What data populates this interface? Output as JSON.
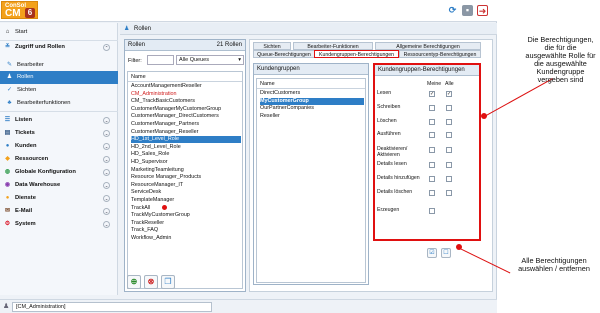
{
  "logo": {
    "line1": "ConSol",
    "line2": "CM",
    "badge": "6"
  },
  "sidebar": {
    "start": "Start",
    "section_access": "Zugriff und Rollen",
    "access_items": [
      {
        "label": "Bearbeiter",
        "icon": "user-edit-icon"
      },
      {
        "label": "Rollen",
        "icon": "roles-icon"
      },
      {
        "label": "Sichten",
        "icon": "check-icon"
      },
      {
        "label": "Bearbeiterfunktionen",
        "icon": "functions-icon"
      }
    ],
    "sections": [
      {
        "label": "Listen",
        "icon": "list-icon"
      },
      {
        "label": "Tickets",
        "icon": "ticket-icon"
      },
      {
        "label": "Kunden",
        "icon": "person-icon"
      },
      {
        "label": "Ressourcen",
        "icon": "resources-icon"
      },
      {
        "label": "Globale Konfiguration",
        "icon": "globe-icon"
      },
      {
        "label": "Data Warehouse",
        "icon": "warehouse-icon"
      },
      {
        "label": "Dienste",
        "icon": "services-icon"
      },
      {
        "label": "E-Mail",
        "icon": "mail-icon"
      },
      {
        "label": "System",
        "icon": "system-icon"
      }
    ]
  },
  "panel_title": "Rollen",
  "roles": {
    "header": "Rollen",
    "count": "21 Rollen",
    "filter_label": "Filter:",
    "filter_select": "Alle Queues",
    "column": "Name",
    "items": [
      "AccountManagementReseller",
      "CM_Administration",
      "CM_TrackBasicCustomers",
      "CustomerManagerMyCustomerGroup",
      "CustomerManager_DirectCustomers",
      "CustomerManager_Partners",
      "CustomerManager_Reseller",
      "HD_1st_Level_Role",
      "HD_2nd_Level_Role",
      "HD_Sales_Role",
      "HD_Supervisor",
      "MarketingTeamleitung",
      "Resource Manager_Products",
      "ResourceManager_IT",
      "ServiceDesk",
      "TemplateManager",
      "TrackAll",
      "TrackMyCustomerGroup",
      "TrackReseller",
      "Track_FAQ",
      "Workflow_Admin"
    ]
  },
  "tabs": {
    "row1": [
      "Sichten",
      "Bearbeiter-Funktionen",
      "Allgemeine Berechtigungen"
    ],
    "row2": [
      "Queue-Berechtigungen",
      "Kundengruppen-Berechtigungen",
      "Ressourcentyp-Berechtigungen"
    ]
  },
  "groups": {
    "header": "Kundengruppen",
    "column": "Name",
    "items": [
      "DirectCustomers",
      "MyCustomerGroup",
      "OurPartnerCompanies",
      "Reseller"
    ]
  },
  "perms": {
    "header": "Kundengruppen-Berechtigungen",
    "col_mine": "Meine",
    "col_all": "Alle",
    "rows": [
      {
        "label": "Lesen",
        "mine": true,
        "all": true
      },
      {
        "label": "Schreiben",
        "mine": false,
        "all": false
      },
      {
        "label": "Löschen",
        "mine": false,
        "all": false
      },
      {
        "label": "Ausführen",
        "mine": false,
        "all": false
      },
      {
        "label": "Deaktivieren/ Aktivieren",
        "mine": false,
        "all": false
      },
      {
        "label": "Details lesen",
        "mine": false,
        "all": false
      },
      {
        "label": "Details hinzufügen",
        "mine": false,
        "all": false
      },
      {
        "label": "Details löschen",
        "mine": false,
        "all": false
      },
      {
        "label": "Erzeugen",
        "mine": false,
        "all": null
      }
    ]
  },
  "status": {
    "user": "[CM_Administration]"
  },
  "annotations": {
    "top": "Die Berechtigungen, die für die ausgewählte Rolle für die ausgewählte Kundengruppe vergeben sind",
    "bottom": "Alle Berechtigungen auswählen / entfernen"
  },
  "colors": {
    "accent": "#2e7ec6",
    "brand": "#f3a11b",
    "annotation": "#e01010"
  }
}
